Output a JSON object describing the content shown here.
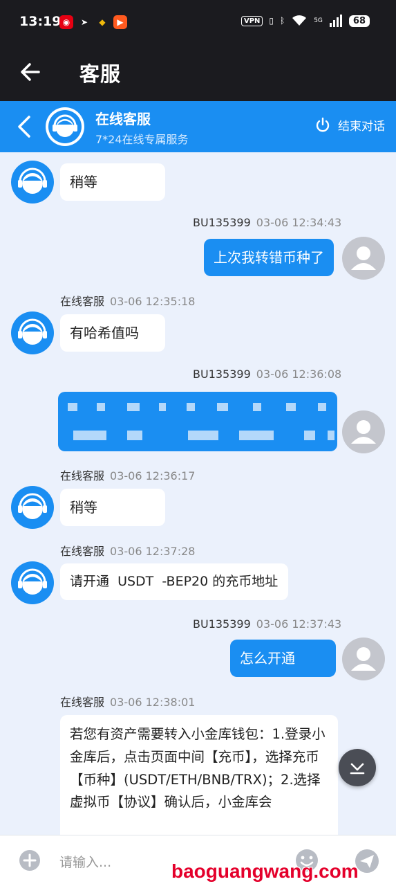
{
  "status_bar": {
    "time": "13:19",
    "vpn": "VPN",
    "network": "5G",
    "battery": "68"
  },
  "app_bar": {
    "title": "客服"
  },
  "chat_header": {
    "name": "在线客服",
    "subtitle": "7*24在线专属服务",
    "end_label": "结束对话"
  },
  "messages": [
    {
      "type": "in",
      "text": "稍等"
    },
    {
      "type": "out",
      "sender": "BU135399",
      "time": "03-06 12:34:43",
      "text": "上次我转错币种了"
    },
    {
      "type": "in",
      "sender": "在线客服",
      "time": "03-06 12:35:18",
      "text": "有哈希值吗"
    },
    {
      "type": "out",
      "sender": "BU135399",
      "time": "03-06 12:36:08",
      "text": ""
    },
    {
      "type": "in",
      "sender": "在线客服",
      "time": "03-06 12:36:17",
      "text": "稍等"
    },
    {
      "type": "in",
      "sender": "在线客服",
      "time": "03-06 12:37:28",
      "text": "请开通  USDT  -BEP20 的充币地址"
    },
    {
      "type": "out",
      "sender": "BU135399",
      "time": "03-06 12:37:43",
      "text": "怎么开通"
    },
    {
      "type": "in",
      "sender": "在线客服",
      "time": "03-06 12:38:01",
      "text": "若您有资产需要转入小金库钱包：1.登录小金库后，点击页面中间【充币】，选择充币【币种】(USDT/ETH/BNB/TRX)；2.选择虚拟币【协议】确认后，小金库会"
    }
  ],
  "input": {
    "placeholder": "请输入..."
  },
  "watermark": "baoguangwang.com",
  "colors": {
    "accent": "#1a8ef2",
    "chat_bg": "#ebf1fc",
    "dark_bar": "#1b1b1f"
  }
}
